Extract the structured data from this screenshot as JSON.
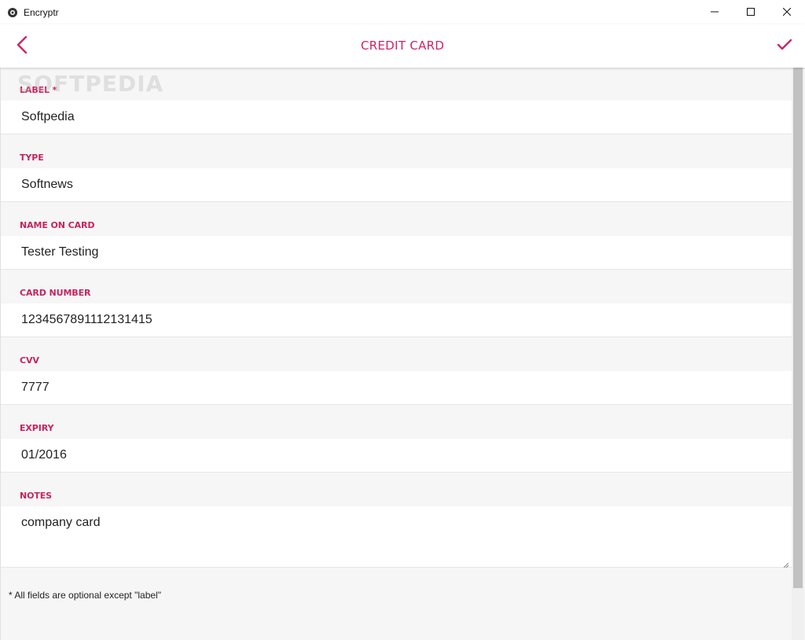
{
  "window": {
    "title": "Encryptr"
  },
  "header": {
    "title": "CREDIT CARD"
  },
  "watermark": "SOFTPEDIA",
  "fields": [
    {
      "label": "LABEL *",
      "value": "Softpedia"
    },
    {
      "label": "TYPE",
      "value": "Softnews"
    },
    {
      "label": "NAME ON CARD",
      "value": "Tester Testing"
    },
    {
      "label": "CARD NUMBER",
      "value": "1234567891112131415"
    },
    {
      "label": "CVV",
      "value": "7777"
    },
    {
      "label": "EXPIRY",
      "value": "01/2016"
    }
  ],
  "notes": {
    "label": "NOTES",
    "value": "company card"
  },
  "footnote": "* All fields are optional except \"label\"",
  "colors": {
    "accent": "#d02466",
    "label": "#c6245f",
    "background": "#f6f6f6"
  },
  "icons": {
    "app": "encryptr-logo-icon",
    "back": "chevron-left-icon",
    "save": "checkmark-icon",
    "minimize": "minimize-icon",
    "maximize": "maximize-icon",
    "close": "close-icon"
  }
}
